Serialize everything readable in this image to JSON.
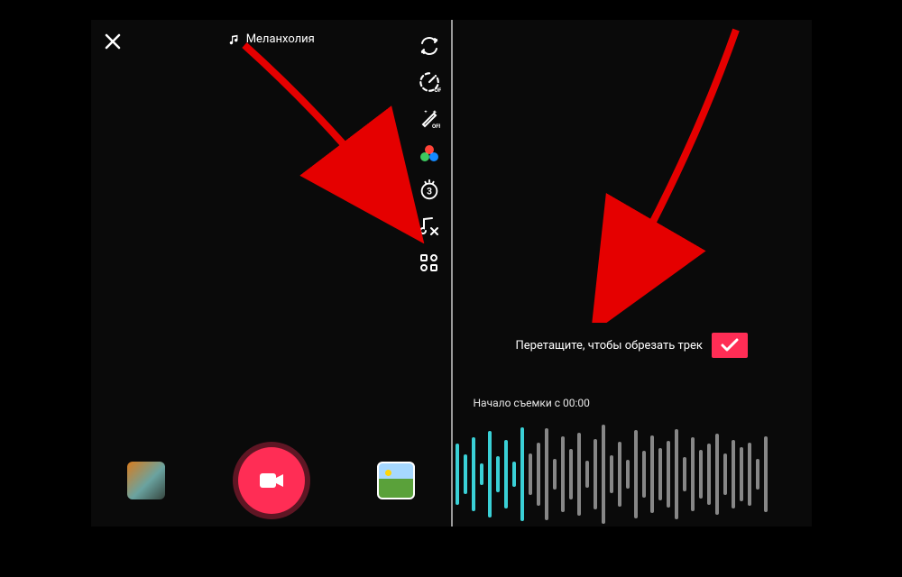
{
  "left": {
    "sound_label": "Меланхолия",
    "tools": {
      "flip": "flip-camera-icon",
      "speed": "speed-icon",
      "beauty": "magic-wand-icon",
      "filters": "filters-icon",
      "timer": "timer-3-icon",
      "trim_sound": "music-trim-icon",
      "more": "grid-icon"
    },
    "bottom": {
      "effects": "effects-thumb",
      "record": "record-button",
      "gallery": "gallery-thumb"
    }
  },
  "right": {
    "trim_instruction": "Перетащите, чтобы обрезать трек",
    "start_label": "Начало съемки с 00:00",
    "waveform": {
      "active_count": 9,
      "bars": [
        58,
        38,
        70,
        20,
        82,
        34,
        66,
        24,
        90,
        40,
        60,
        88,
        30,
        72,
        48,
        80,
        26,
        68,
        94,
        36,
        62,
        28,
        84,
        44,
        74,
        50,
        64,
        86,
        32,
        70,
        46,
        58,
        78,
        40,
        66,
        52,
        60,
        30,
        72
      ],
      "active_color": "#3ad0d6",
      "inactive_color": "#878787"
    },
    "confirm_icon": "checkmark-icon"
  },
  "annotations": {
    "arrow_color": "#e50000"
  }
}
